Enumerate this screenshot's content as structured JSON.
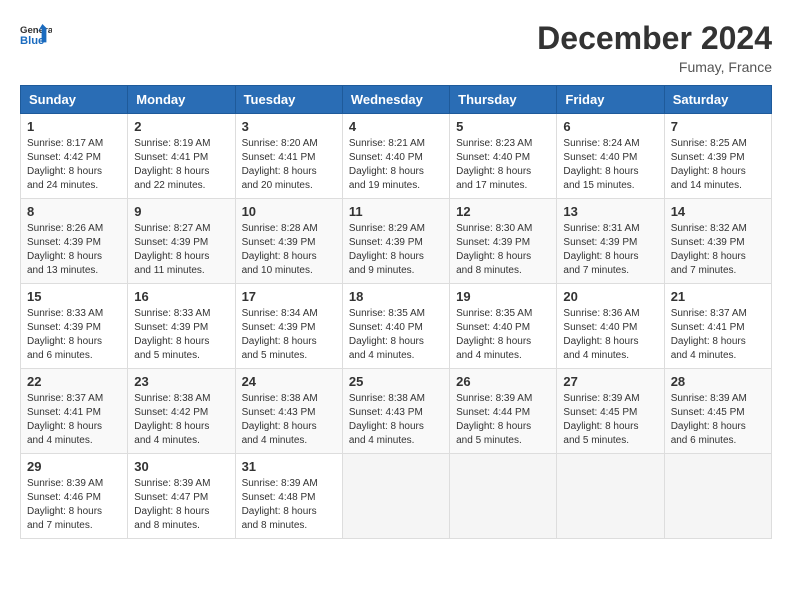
{
  "header": {
    "logo_line1": "General",
    "logo_line2": "Blue",
    "month": "December 2024",
    "location": "Fumay, France"
  },
  "weekdays": [
    "Sunday",
    "Monday",
    "Tuesday",
    "Wednesday",
    "Thursday",
    "Friday",
    "Saturday"
  ],
  "weeks": [
    [
      {
        "day": 1,
        "sunrise": "8:17 AM",
        "sunset": "4:42 PM",
        "daylight": "8 hours and 24 minutes"
      },
      {
        "day": 2,
        "sunrise": "8:19 AM",
        "sunset": "4:41 PM",
        "daylight": "8 hours and 22 minutes"
      },
      {
        "day": 3,
        "sunrise": "8:20 AM",
        "sunset": "4:41 PM",
        "daylight": "8 hours and 20 minutes"
      },
      {
        "day": 4,
        "sunrise": "8:21 AM",
        "sunset": "4:40 PM",
        "daylight": "8 hours and 19 minutes"
      },
      {
        "day": 5,
        "sunrise": "8:23 AM",
        "sunset": "4:40 PM",
        "daylight": "8 hours and 17 minutes"
      },
      {
        "day": 6,
        "sunrise": "8:24 AM",
        "sunset": "4:40 PM",
        "daylight": "8 hours and 15 minutes"
      },
      {
        "day": 7,
        "sunrise": "8:25 AM",
        "sunset": "4:39 PM",
        "daylight": "8 hours and 14 minutes"
      }
    ],
    [
      {
        "day": 8,
        "sunrise": "8:26 AM",
        "sunset": "4:39 PM",
        "daylight": "8 hours and 13 minutes"
      },
      {
        "day": 9,
        "sunrise": "8:27 AM",
        "sunset": "4:39 PM",
        "daylight": "8 hours and 11 minutes"
      },
      {
        "day": 10,
        "sunrise": "8:28 AM",
        "sunset": "4:39 PM",
        "daylight": "8 hours and 10 minutes"
      },
      {
        "day": 11,
        "sunrise": "8:29 AM",
        "sunset": "4:39 PM",
        "daylight": "8 hours and 9 minutes"
      },
      {
        "day": 12,
        "sunrise": "8:30 AM",
        "sunset": "4:39 PM",
        "daylight": "8 hours and 8 minutes"
      },
      {
        "day": 13,
        "sunrise": "8:31 AM",
        "sunset": "4:39 PM",
        "daylight": "8 hours and 7 minutes"
      },
      {
        "day": 14,
        "sunrise": "8:32 AM",
        "sunset": "4:39 PM",
        "daylight": "8 hours and 7 minutes"
      }
    ],
    [
      {
        "day": 15,
        "sunrise": "8:33 AM",
        "sunset": "4:39 PM",
        "daylight": "8 hours and 6 minutes"
      },
      {
        "day": 16,
        "sunrise": "8:33 AM",
        "sunset": "4:39 PM",
        "daylight": "8 hours and 5 minutes"
      },
      {
        "day": 17,
        "sunrise": "8:34 AM",
        "sunset": "4:39 PM",
        "daylight": "8 hours and 5 minutes"
      },
      {
        "day": 18,
        "sunrise": "8:35 AM",
        "sunset": "4:40 PM",
        "daylight": "8 hours and 4 minutes"
      },
      {
        "day": 19,
        "sunrise": "8:35 AM",
        "sunset": "4:40 PM",
        "daylight": "8 hours and 4 minutes"
      },
      {
        "day": 20,
        "sunrise": "8:36 AM",
        "sunset": "4:40 PM",
        "daylight": "8 hours and 4 minutes"
      },
      {
        "day": 21,
        "sunrise": "8:37 AM",
        "sunset": "4:41 PM",
        "daylight": "8 hours and 4 minutes"
      }
    ],
    [
      {
        "day": 22,
        "sunrise": "8:37 AM",
        "sunset": "4:41 PM",
        "daylight": "8 hours and 4 minutes"
      },
      {
        "day": 23,
        "sunrise": "8:38 AM",
        "sunset": "4:42 PM",
        "daylight": "8 hours and 4 minutes"
      },
      {
        "day": 24,
        "sunrise": "8:38 AM",
        "sunset": "4:43 PM",
        "daylight": "8 hours and 4 minutes"
      },
      {
        "day": 25,
        "sunrise": "8:38 AM",
        "sunset": "4:43 PM",
        "daylight": "8 hours and 4 minutes"
      },
      {
        "day": 26,
        "sunrise": "8:39 AM",
        "sunset": "4:44 PM",
        "daylight": "8 hours and 5 minutes"
      },
      {
        "day": 27,
        "sunrise": "8:39 AM",
        "sunset": "4:45 PM",
        "daylight": "8 hours and 5 minutes"
      },
      {
        "day": 28,
        "sunrise": "8:39 AM",
        "sunset": "4:45 PM",
        "daylight": "8 hours and 6 minutes"
      }
    ],
    [
      {
        "day": 29,
        "sunrise": "8:39 AM",
        "sunset": "4:46 PM",
        "daylight": "8 hours and 7 minutes"
      },
      {
        "day": 30,
        "sunrise": "8:39 AM",
        "sunset": "4:47 PM",
        "daylight": "8 hours and 8 minutes"
      },
      {
        "day": 31,
        "sunrise": "8:39 AM",
        "sunset": "4:48 PM",
        "daylight": "8 hours and 8 minutes"
      },
      null,
      null,
      null,
      null
    ]
  ]
}
